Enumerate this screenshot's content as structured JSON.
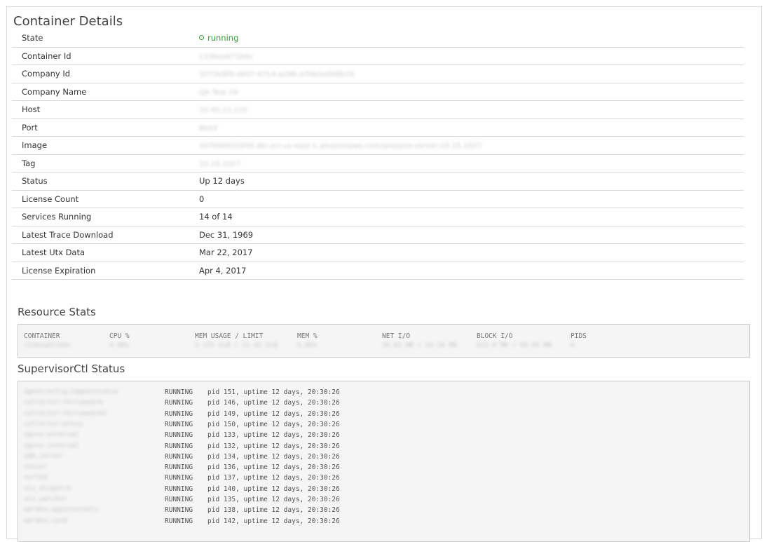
{
  "panel": {
    "title": "Container Details"
  },
  "details": [
    {
      "key": "State",
      "value": "running",
      "kind": "state"
    },
    {
      "key": "Container Id",
      "value": "1336aa671b9c",
      "kind": "blurred"
    },
    {
      "key": "Company Id",
      "value": "3273e9f9-d457-4714-a286-a70b2e008b19",
      "kind": "blurred"
    },
    {
      "key": "Company Name",
      "value": "QA Test 19",
      "kind": "blurred"
    },
    {
      "key": "Host",
      "value": "10.45.12.125",
      "kind": "blurred"
    },
    {
      "key": "Port",
      "value": "8043",
      "kind": "blurred"
    },
    {
      "key": "Image",
      "value": "347000031850.dkr.ecr.us-east-1.amazonaws.com/analysis-server:10.15.1027",
      "kind": "blurred"
    },
    {
      "key": "Tag",
      "value": "10.15.1027",
      "kind": "blurred"
    },
    {
      "key": "Status",
      "value": "Up 12 days",
      "kind": "text"
    },
    {
      "key": "License Count",
      "value": "0",
      "kind": "text"
    },
    {
      "key": "Services Running",
      "value": "14 of 14",
      "kind": "text"
    },
    {
      "key": "Latest Trace Download",
      "value": "Dec 31, 1969",
      "kind": "text"
    },
    {
      "key": "Latest Utx Data",
      "value": "Mar 22, 2017",
      "kind": "text"
    },
    {
      "key": "License Expiration",
      "value": "Apr 4, 2017",
      "kind": "text"
    }
  ],
  "resource_stats": {
    "title": "Resource Stats",
    "headers": [
      "CONTAINER",
      "CPU %",
      "MEM USAGE / LIMIT",
      "MEM %",
      "NET I/O",
      "BLOCK I/O",
      "PIDS"
    ],
    "values": [
      "1336aa671b9c",
      "4.00%",
      "2.155 GiB / 31.42 GiB",
      "6.86%",
      "39.85 MB / 18.38 MB",
      "615.9 MB / 98.05 MB",
      "0"
    ]
  },
  "supervisor": {
    "title": "SupervisorCtl Status",
    "rows": [
      {
        "name": "agentconfig:nagentstatus",
        "state": "RUNNING",
        "info": "pid 151, uptime 12 days, 20:30:26"
      },
      {
        "name": "collector:ferryaware",
        "state": "RUNNING",
        "info": "pid 146, uptime 12 days, 20:30:26"
      },
      {
        "name": "collector:ferryaware2",
        "state": "RUNNING",
        "info": "pid 149, uptime 12 days, 20:30:26"
      },
      {
        "name": "collector:proxy",
        "state": "RUNNING",
        "info": "pid 150, uptime 12 days, 20:30:26"
      },
      {
        "name": "nginx:external",
        "state": "RUNNING",
        "info": "pid 133, uptime 12 days, 20:30:26"
      },
      {
        "name": "nginx:internal",
        "state": "RUNNING",
        "info": "pid 132, uptime 12 days, 20:30:26"
      },
      {
        "name": "odb_server",
        "state": "RUNNING",
        "info": "pid 134, uptime 12 days, 20:30:26"
      },
      {
        "name": "sessor",
        "state": "RUNNING",
        "info": "pid 136, uptime 12 days, 20:30:26"
      },
      {
        "name": "sorted",
        "state": "RUNNING",
        "info": "pid 137, uptime 12 days, 20:30:26"
      },
      {
        "name": "utx_dispatch",
        "state": "RUNNING",
        "info": "pid 140, uptime 12 days, 20:30:26"
      },
      {
        "name": "utx_watcher",
        "state": "RUNNING",
        "info": "pid 135, uptime 12 days, 20:30:26"
      },
      {
        "name": "warden:appinternals",
        "state": "RUNNING",
        "info": "pid 138, uptime 12 days, 20:30:26"
      },
      {
        "name": "warden:card",
        "state": "RUNNING",
        "info": "pid 142, uptime 12 days, 20:30:26"
      }
    ]
  },
  "colors": {
    "running": "#3a9a3a",
    "border": "#d8d8d8",
    "code_bg": "#f5f5f5"
  }
}
